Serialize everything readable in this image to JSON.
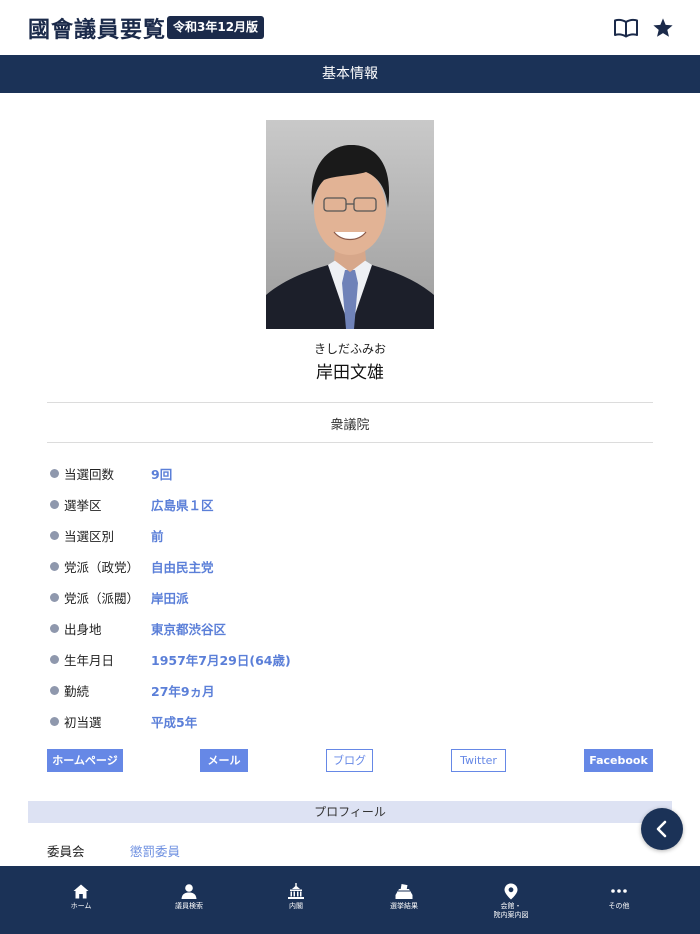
{
  "header": {
    "title": "國會議員要覧",
    "edition": "令和3年12月版",
    "icons": [
      "book-icon",
      "star-icon"
    ]
  },
  "section": {
    "title": "基本情報"
  },
  "member": {
    "kana": "きしだふみお",
    "name": "岸田文雄",
    "house": "衆議院"
  },
  "info": [
    {
      "label": "当選回数",
      "value": "9回"
    },
    {
      "label": "選挙区",
      "value": "広島県１区"
    },
    {
      "label": "当選区別",
      "value": "前"
    },
    {
      "label": "党派（政党）",
      "value": "自由民主党"
    },
    {
      "label": "党派（派閥）",
      "value": "岸田派"
    },
    {
      "label": "出身地",
      "value": "東京都渋谷区"
    },
    {
      "label": "生年月日",
      "value": "1957年7月29日(64歳)"
    },
    {
      "label": "勤続",
      "value": "27年9ヵ月"
    },
    {
      "label": "初当選",
      "value": "平成5年"
    }
  ],
  "links": {
    "homepage": "ホームページ",
    "mail": "メール",
    "blog": "ブログ",
    "twitter": "Twitter",
    "facebook": "Facebook"
  },
  "profile": {
    "title": "プロフィール",
    "committee_label": "委員会",
    "committee_value": "懲罰委員"
  },
  "nav": {
    "home": "ホーム",
    "search": "議員検索",
    "cabinet": "内閣",
    "election": "選挙結果",
    "map": "会館・\n院内案内図",
    "other": "その他"
  },
  "colors": {
    "navy": "#1b3257",
    "link_blue": "#6688e6",
    "profile_bar": "#dde2f3"
  }
}
